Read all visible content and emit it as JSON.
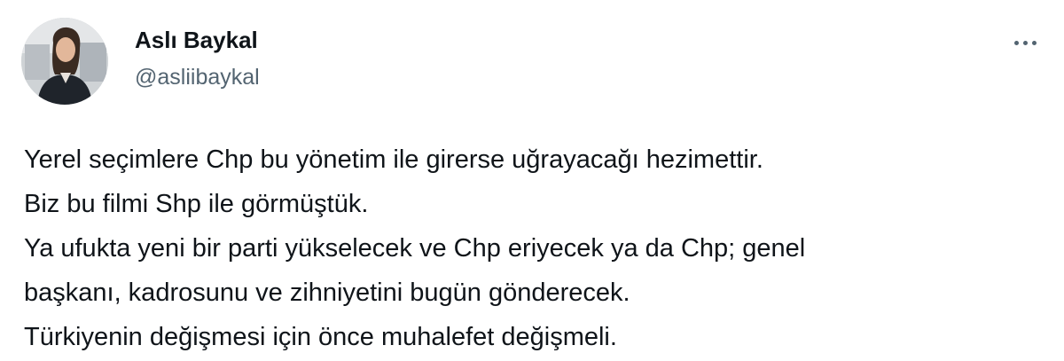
{
  "author": {
    "display_name": "Aslı Baykal",
    "handle": "@asliibaykal",
    "avatar_icon": "profile-photo"
  },
  "menu": {
    "more_icon": "more-horizontal-icon"
  },
  "tweet": {
    "lines": [
      "Yerel seçimlere Chp bu yönetim ile girerse uğrayacağı hezimettir.",
      "Biz bu filmi Shp ile görmüştük.",
      "Ya ufukta yeni bir parti yükselecek ve Chp eriyecek ya da Chp; genel",
      "başkanı, kadrosunu ve zihniyetini bugün gönderecek.",
      "Türkiyenin değişmesi için önce muhalefet değişmeli."
    ]
  },
  "colors": {
    "text_primary": "#0f1419",
    "text_secondary": "#536471",
    "background": "#ffffff"
  }
}
